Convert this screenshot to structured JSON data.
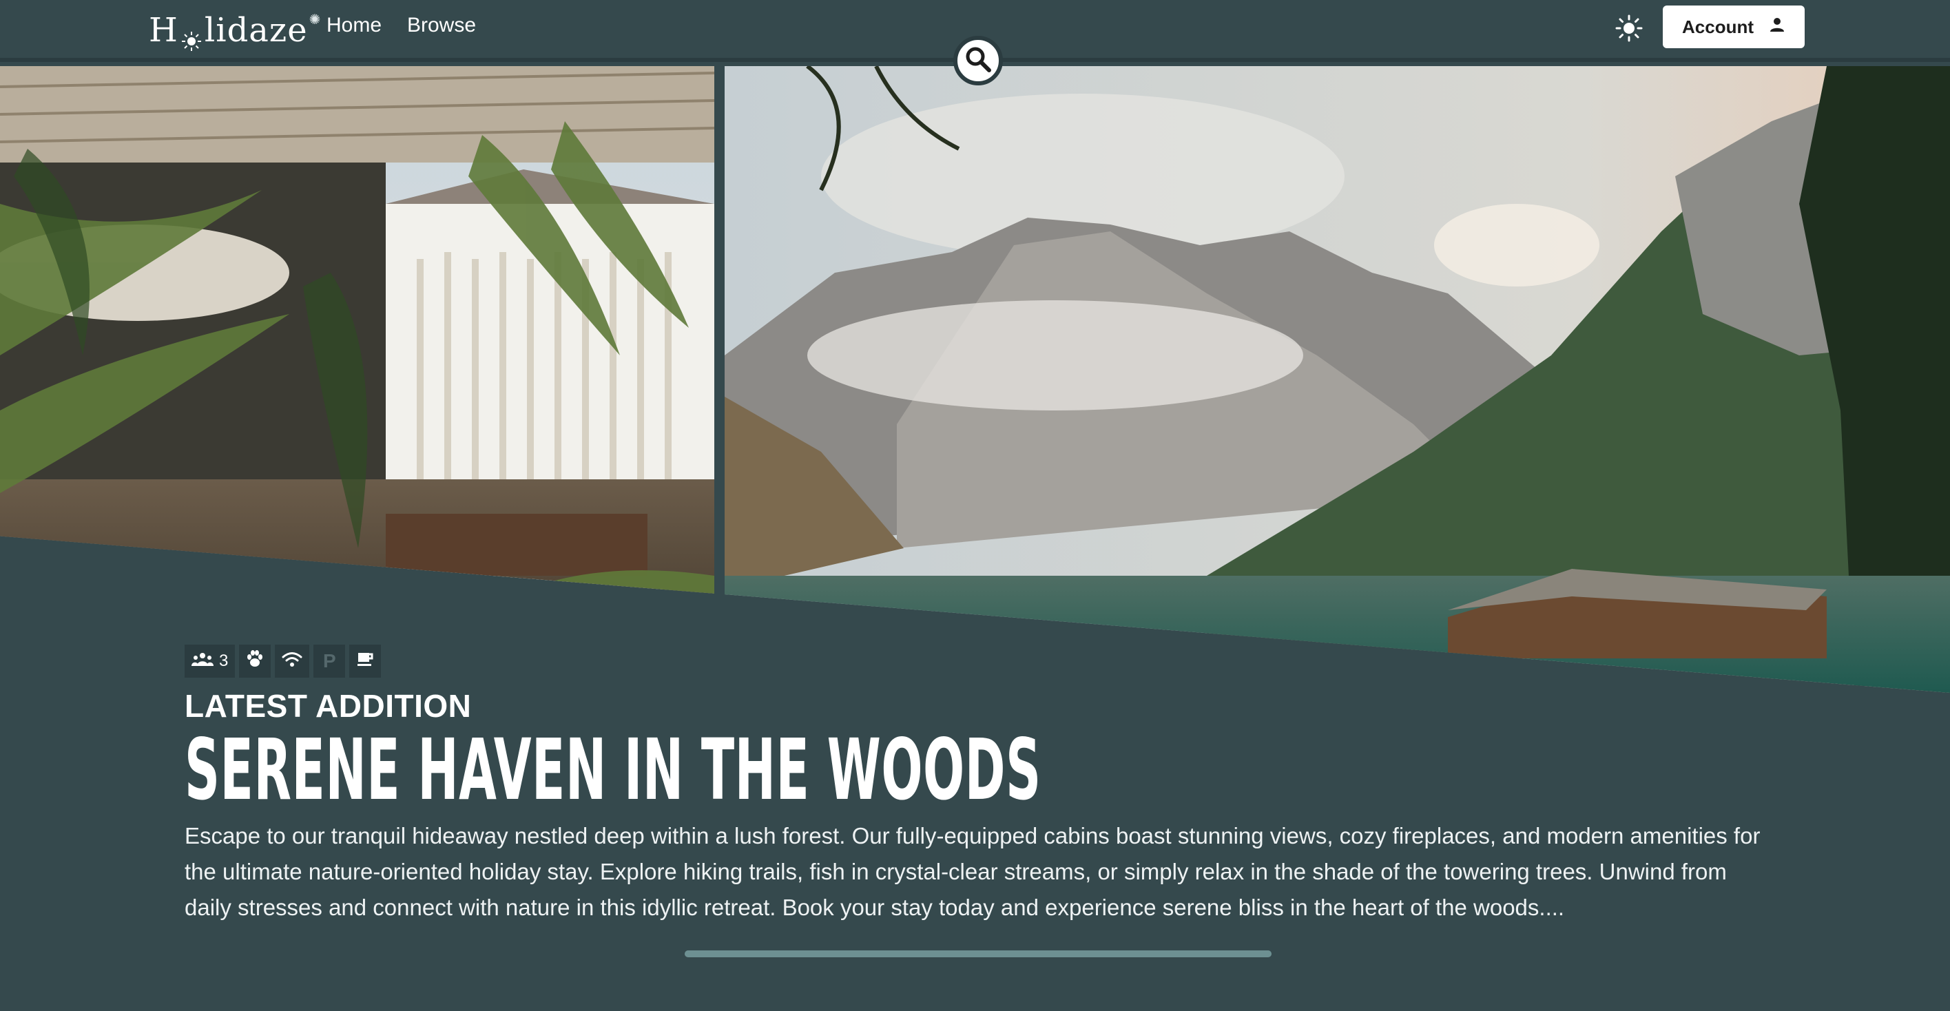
{
  "header": {
    "logo_text_left": "H",
    "logo_text_right": "lidaze",
    "nav": [
      {
        "label": "Home"
      },
      {
        "label": "Browse"
      }
    ],
    "account_label": "Account"
  },
  "icons": {
    "logo_sun": "sun-icon",
    "theme_toggle": "sun-icon",
    "account": "person-icon",
    "search": "search-icon",
    "guests": "people-icon",
    "pets": "paw-icon",
    "wifi": "wifi-icon",
    "parking": "parking-icon",
    "breakfast": "coffee-icon"
  },
  "listing": {
    "amenities": {
      "guests_count": "3",
      "parking_letter": "P"
    },
    "eyebrow": "LATEST ADDITION",
    "title": "Serene Haven in the Woods",
    "description": "Escape to our tranquil hideaway nestled deep within a lush forest. Our fully-equipped cabins boast stunning views, cozy fireplaces, and modern amenities for the ultimate nature-oriented holiday stay. Explore hiking trails, fish in crystal-clear streams, or simply relax in the shade of the towering trees. Unwind from daily stresses and connect with nature in this idyllic retreat. Book your stay today and experience serene bliss in the heart of the woods...."
  },
  "carousel": {
    "progress_fraction": 1.0
  },
  "colors": {
    "background": "#35494d",
    "dark_accent": "#2b3c40",
    "progress": "#6d9092",
    "button_bg": "#ffffff"
  }
}
